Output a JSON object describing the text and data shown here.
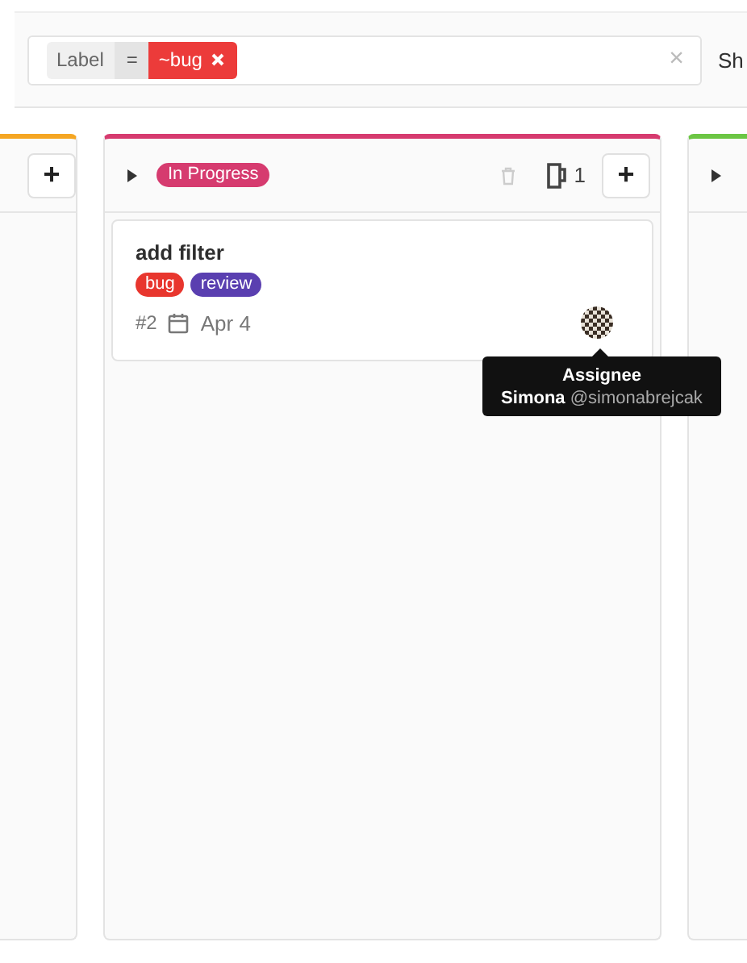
{
  "filter": {
    "token": {
      "key": "Label",
      "operator": "=",
      "value": "~bug",
      "color": "#ec3b3a"
    },
    "clear_symbol": "×"
  },
  "show_text": "Sh",
  "columns": [
    {
      "kind": "partial-left",
      "color": "#f5a623",
      "add_symbol": "+"
    },
    {
      "kind": "full",
      "color": "#d63b6f",
      "title": {
        "text": "In Progress",
        "color": "#d63b6f"
      },
      "count": "1",
      "add_symbol": "+",
      "cards": [
        {
          "title": "add filter",
          "labels": [
            {
              "text": "bug",
              "color": "#e8362e"
            },
            {
              "text": "review",
              "color": "#5a3fb0"
            }
          ],
          "number": "#2",
          "due": "Apr 4",
          "tooltip": {
            "title": "Assignee",
            "name": "Simona",
            "handle": "@simonabrejcak"
          }
        }
      ]
    },
    {
      "kind": "partial-right",
      "color": "#6cc644"
    }
  ]
}
